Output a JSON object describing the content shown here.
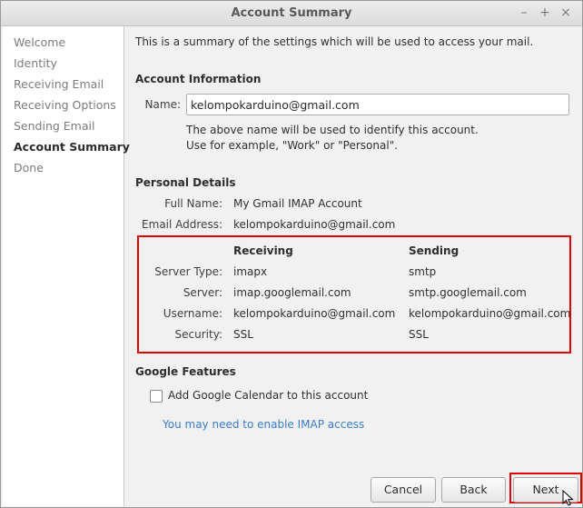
{
  "window": {
    "title": "Account Summary"
  },
  "sidebar": {
    "items": [
      {
        "label": "Welcome"
      },
      {
        "label": "Identity"
      },
      {
        "label": "Receiving Email"
      },
      {
        "label": "Receiving Options"
      },
      {
        "label": "Sending Email"
      },
      {
        "label": "Account Summary",
        "active": true
      },
      {
        "label": "Done"
      }
    ]
  },
  "main": {
    "intro": "This is a summary of the settings which will be used to access your mail.",
    "account_info": {
      "heading": "Account Information",
      "name_label": "Name:",
      "name_value": "kelompokarduino@gmail.com",
      "hint_line1": "The above name will be used to identify this account.",
      "hint_line2": "Use for example, \"Work\" or \"Personal\"."
    },
    "personal": {
      "heading": "Personal Details",
      "full_name_label": "Full Name:",
      "full_name": "My Gmail IMAP Account",
      "email_label": "Email Address:",
      "email": "kelompokarduino@gmail.com"
    },
    "servers": {
      "receiving_heading": "Receiving",
      "sending_heading": "Sending",
      "rows": [
        {
          "label": "Server Type:",
          "receiving": "imapx",
          "sending": "smtp"
        },
        {
          "label": "Server:",
          "receiving": "imap.googlemail.com",
          "sending": "smtp.googlemail.com"
        },
        {
          "label": "Username:",
          "receiving": "kelompokarduino@gmail.com",
          "sending": "kelompokarduino@gmail.com"
        },
        {
          "label": "Security:",
          "receiving": "SSL",
          "sending": "SSL"
        }
      ]
    },
    "google": {
      "heading": "Google Features",
      "calendar_label": "Add Google Calendar to this account",
      "calendar_checked": false,
      "imap_link": "You may need to enable IMAP access"
    }
  },
  "buttons": {
    "cancel": "Cancel",
    "back": "Back",
    "next": "Next"
  },
  "colors": {
    "highlight": "#e00000",
    "link": "#3a7ec6"
  }
}
